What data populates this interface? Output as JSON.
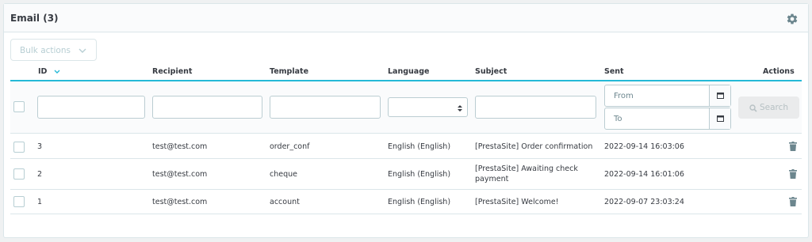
{
  "panel": {
    "title": "Email (3)",
    "settings_icon": "gear-icon"
  },
  "bulk_actions": {
    "label": "Bulk actions",
    "icon": "chevron-down-icon"
  },
  "columns": {
    "id": "ID",
    "id_sort_icon": "chevron-down-icon",
    "recipient": "Recipient",
    "template": "Template",
    "language": "Language",
    "subject": "Subject",
    "sent": "Sent",
    "actions": "Actions"
  },
  "filters": {
    "id": "",
    "recipient": "",
    "template": "",
    "language": "",
    "subject": "",
    "sent_from_placeholder": "From",
    "sent_to_placeholder": "To",
    "search_label": "Search",
    "search_icon": "search-icon",
    "calendar_icon": "calendar-icon"
  },
  "rows": [
    {
      "id": "3",
      "recipient": "test@test.com",
      "template": "order_conf",
      "language": "English (English)",
      "subject": "[PrestaSite] Order confirmation",
      "sent": "2022-09-14 16:03:06",
      "action_icon": "trash-icon"
    },
    {
      "id": "2",
      "recipient": "test@test.com",
      "template": "cheque",
      "language": "English (English)",
      "subject": "[PrestaSite] Awaiting check payment",
      "sent": "2022-09-14 16:01:06",
      "action_icon": "trash-icon"
    },
    {
      "id": "1",
      "recipient": "test@test.com",
      "template": "account",
      "language": "English (English)",
      "subject": "[PrestaSite] Welcome!",
      "sent": "2022-09-07 23:03:24",
      "action_icon": "trash-icon"
    }
  ],
  "colors": {
    "accent": "#25b9d7",
    "text": "#363a41",
    "border": "#dbe6e9",
    "icon": "#6c868e"
  }
}
